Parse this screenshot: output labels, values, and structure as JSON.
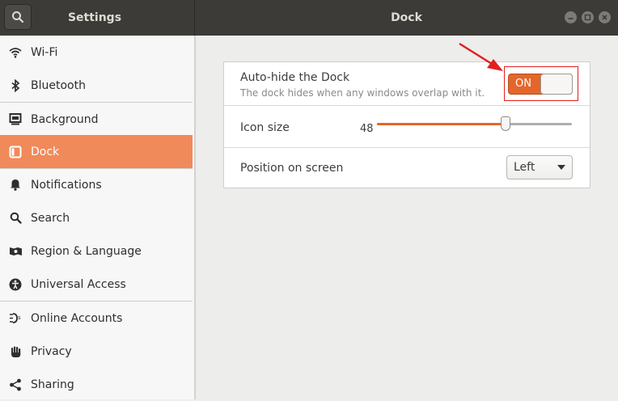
{
  "titlebar": {
    "app_title": "Settings",
    "page_title": "Dock"
  },
  "sidebar": {
    "items": [
      {
        "label": "Wi-Fi",
        "icon": "wifi-icon"
      },
      {
        "label": "Bluetooth",
        "icon": "bluetooth-icon"
      },
      {
        "label": "Background",
        "icon": "background-icon"
      },
      {
        "label": "Dock",
        "icon": "dock-icon",
        "active": true
      },
      {
        "label": "Notifications",
        "icon": "bell-icon"
      },
      {
        "label": "Search",
        "icon": "search-icon"
      },
      {
        "label": "Region & Language",
        "icon": "region-icon"
      },
      {
        "label": "Universal Access",
        "icon": "accessibility-icon"
      },
      {
        "label": "Online Accounts",
        "icon": "online-accounts-icon"
      },
      {
        "label": "Privacy",
        "icon": "hand-icon"
      },
      {
        "label": "Sharing",
        "icon": "share-icon"
      }
    ]
  },
  "dock": {
    "autohide": {
      "label": "Auto-hide the Dock",
      "description": "The dock hides when any windows overlap with it.",
      "toggle_text": "ON",
      "state": true
    },
    "icon_size": {
      "label": "Icon size",
      "value": "48",
      "fraction": 0.66
    },
    "position": {
      "label": "Position on screen",
      "selected": "Left"
    }
  },
  "colors": {
    "accent": "#e4662b",
    "active_sidebar": "#f08a5b",
    "titlebar": "#3c3b37",
    "annotation": "#e02020"
  }
}
